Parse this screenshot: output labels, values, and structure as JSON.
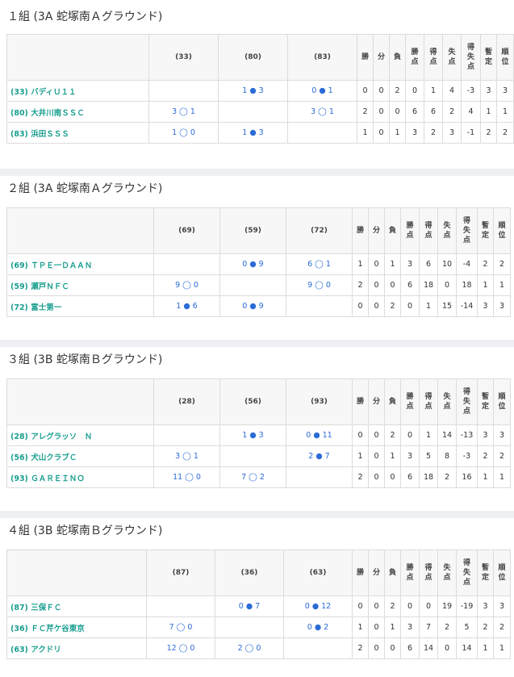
{
  "groups": [
    {
      "title": "１組 (3A 蛇塚南Ａグラウンド)",
      "columns": [
        "(33)",
        "(80)",
        "(83)"
      ],
      "stat_headers": [
        "勝",
        "分",
        "負",
        "勝点",
        "得点",
        "失点",
        "得失点",
        "暫定",
        "順位"
      ],
      "rows": [
        {
          "team": "(33) バディＵ１１",
          "results": [
            "",
            "1 ● 3",
            "0 ● 1"
          ],
          "stats": [
            "0",
            "0",
            "2",
            "0",
            "1",
            "4",
            "-3",
            "3",
            "3"
          ]
        },
        {
          "team": "(80) 大井川南ＳＳＣ",
          "results": [
            "3 ◯ 1",
            "",
            "3 ◯ 1"
          ],
          "stats": [
            "2",
            "0",
            "0",
            "6",
            "6",
            "2",
            "4",
            "1",
            "1"
          ]
        },
        {
          "team": "(83) 浜田ＳＳＳ",
          "results": [
            "1 ◯ 0",
            "1 ● 3",
            ""
          ],
          "stats": [
            "1",
            "0",
            "1",
            "3",
            "2",
            "3",
            "-1",
            "2",
            "2"
          ]
        }
      ]
    },
    {
      "title": "２組 (3A 蛇塚南Ａグラウンド)",
      "columns": [
        "(69)",
        "(59)",
        "(72)"
      ],
      "stat_headers": [
        "勝",
        "分",
        "負",
        "勝点",
        "得点",
        "失点",
        "得失点",
        "暫定",
        "順位"
      ],
      "rows": [
        {
          "team": "(69) ＴＰＥ一ＤＡＡＮ",
          "results": [
            "",
            "0 ● 9",
            "6 ◯ 1"
          ],
          "stats": [
            "1",
            "0",
            "1",
            "3",
            "6",
            "10",
            "-4",
            "2",
            "2"
          ]
        },
        {
          "team": "(59) 瀬戸ＮＦＣ",
          "results": [
            "9 ◯ 0",
            "",
            "9 ◯ 0"
          ],
          "stats": [
            "2",
            "0",
            "0",
            "6",
            "18",
            "0",
            "18",
            "1",
            "1"
          ]
        },
        {
          "team": "(72) 富士第一",
          "results": [
            "1 ● 6",
            "0 ● 9",
            ""
          ],
          "stats": [
            "0",
            "0",
            "2",
            "0",
            "1",
            "15",
            "-14",
            "3",
            "3"
          ]
        }
      ]
    },
    {
      "title": "３組 (3B 蛇塚南Ｂグラウンド)",
      "columns": [
        "(28)",
        "(56)",
        "(93)"
      ],
      "stat_headers": [
        "勝",
        "分",
        "負",
        "勝点",
        "得点",
        "失点",
        "得失点",
        "暫定",
        "順位"
      ],
      "rows": [
        {
          "team": "(28) アレグラッソ　Ｎ",
          "results": [
            "",
            "1 ● 3",
            "0 ● 11"
          ],
          "stats": [
            "0",
            "0",
            "2",
            "0",
            "1",
            "14",
            "-13",
            "3",
            "3"
          ]
        },
        {
          "team": "(56) 犬山クラブＣ",
          "results": [
            "3 ◯ 1",
            "",
            "2 ● 7"
          ],
          "stats": [
            "1",
            "0",
            "1",
            "3",
            "5",
            "8",
            "-3",
            "2",
            "2"
          ]
        },
        {
          "team": "(93) ＧＡＲＥＩＮＯ",
          "results": [
            "11 ◯ 0",
            "7 ◯ 2",
            ""
          ],
          "stats": [
            "2",
            "0",
            "0",
            "6",
            "18",
            "2",
            "16",
            "1",
            "1"
          ]
        }
      ]
    },
    {
      "title": "４組 (3B 蛇塚南Ｂグラウンド)",
      "columns": [
        "(87)",
        "(36)",
        "(63)"
      ],
      "stat_headers": [
        "勝",
        "分",
        "負",
        "勝点",
        "得点",
        "失点",
        "得失点",
        "暫定",
        "順位"
      ],
      "rows": [
        {
          "team": "(87) 三保ＦＣ",
          "results": [
            "",
            "0 ● 7",
            "0 ● 12"
          ],
          "stats": [
            "0",
            "0",
            "2",
            "0",
            "0",
            "19",
            "-19",
            "3",
            "3"
          ]
        },
        {
          "team": "(36) ＦＣ芹ケ谷東京",
          "results": [
            "7 ◯ 0",
            "",
            "0 ● 2"
          ],
          "stats": [
            "1",
            "0",
            "1",
            "3",
            "7",
            "2",
            "5",
            "2",
            "2"
          ]
        },
        {
          "team": "(63) アクドリ",
          "results": [
            "12 ◯ 0",
            "2 ◯ 0",
            ""
          ],
          "stats": [
            "2",
            "0",
            "0",
            "6",
            "14",
            "0",
            "14",
            "1",
            "1"
          ]
        }
      ]
    }
  ]
}
